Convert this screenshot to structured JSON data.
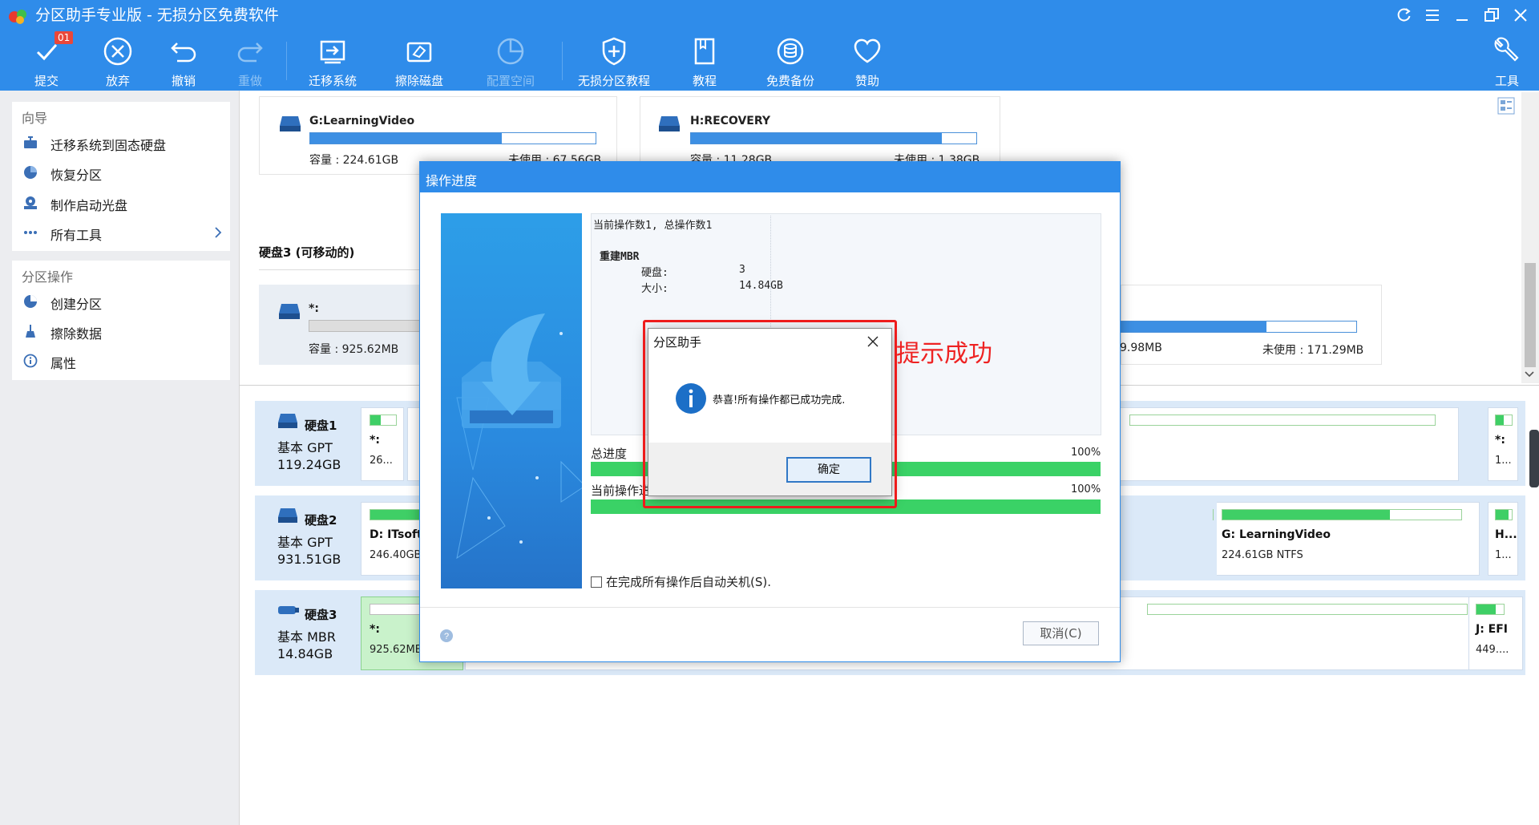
{
  "app": {
    "title": "分区助手专业版 - 无损分区免费软件"
  },
  "toolbar": {
    "commit": {
      "label": "提交",
      "badge": "01"
    },
    "discard": "放弃",
    "undo": "撤销",
    "redo": "重做",
    "migrate": "迁移系统",
    "wipe": "擦除磁盘",
    "alloc": "配置空间",
    "tutorial_lossless": "无损分区教程",
    "tutorial": "教程",
    "backup": "免费备份",
    "donate": "赞助",
    "tools": "工具"
  },
  "sidebar": {
    "wizard": {
      "title": "向导",
      "items": [
        "迁移系统到固态硬盘",
        "恢复分区",
        "制作启动光盘",
        "所有工具"
      ]
    },
    "ops": {
      "title": "分区操作",
      "items": [
        "创建分区",
        "擦除数据",
        "属性"
      ]
    }
  },
  "partitions_top": [
    {
      "name": "G:LearningVideo",
      "capacity": "容量 : 224.61GB",
      "free": "未使用 : 67.56GB",
      "used_fraction": 0.67
    },
    {
      "name": "H:RECOVERY",
      "capacity": "容量 : 11.28GB",
      "free": "未使用 : 1.38GB",
      "used_fraction": 0.88
    }
  ],
  "disk3_section": {
    "title": "硬盘3 (可移动的)",
    "card_a": {
      "name": "*:",
      "capacity": "容量 : 925.62MB"
    },
    "card_b": {
      "capacity_partial": "9.98MB",
      "free": "未使用 : 171.29MB",
      "used_fraction": 0.62
    }
  },
  "disks": [
    {
      "name": "硬盘1",
      "type": "基本 GPT",
      "size": "119.24GB",
      "seg1": {
        "name": "*:",
        "sub": "26..."
      },
      "seg_last": {
        "name": "*:",
        "sub": "1..."
      }
    },
    {
      "name": "硬盘2",
      "type": "基本 GPT",
      "size": "931.51GB",
      "seg1": {
        "name": "D: ITsoft",
        "sub": "246.40GB"
      },
      "seg_g": {
        "name": "G: LearningVideo",
        "sub": "224.61GB NTFS",
        "used_fraction": 0.7
      },
      "seg_last": {
        "name": "H...",
        "sub": "1..."
      }
    },
    {
      "name": "硬盘3",
      "type": "基本 MBR",
      "size": "14.84GB",
      "seg1": {
        "name": "*:",
        "sub": "925.62MB"
      },
      "seg_last": {
        "name": "J: EFI",
        "sub": "449...."
      }
    }
  ],
  "dialog": {
    "title": "操作进度",
    "log": {
      "line1": "当前操作数1, 总操作数1",
      "op_title": "重建MBR",
      "disk_label": "硬盘:",
      "disk_value": "3",
      "size_label": "大小:",
      "size_value": "14.84GB"
    },
    "total_label": "总进度",
    "total_pct": "100%",
    "total_value": 1.0,
    "current_label": "当前操作进度",
    "current_pct": "100%",
    "current_value": 1.0,
    "auto_shutdown": "在完成所有操作后自动关机(S).",
    "cancel": "取消(C)"
  },
  "msgbox": {
    "title": "分区助手",
    "text": "恭喜!所有操作都已成功完成.",
    "ok": "确定"
  },
  "annotation": "提示成功",
  "colors": {
    "accent": "#2f8cea",
    "progress": "#3ad266",
    "highlight": "#ee1c1c"
  }
}
